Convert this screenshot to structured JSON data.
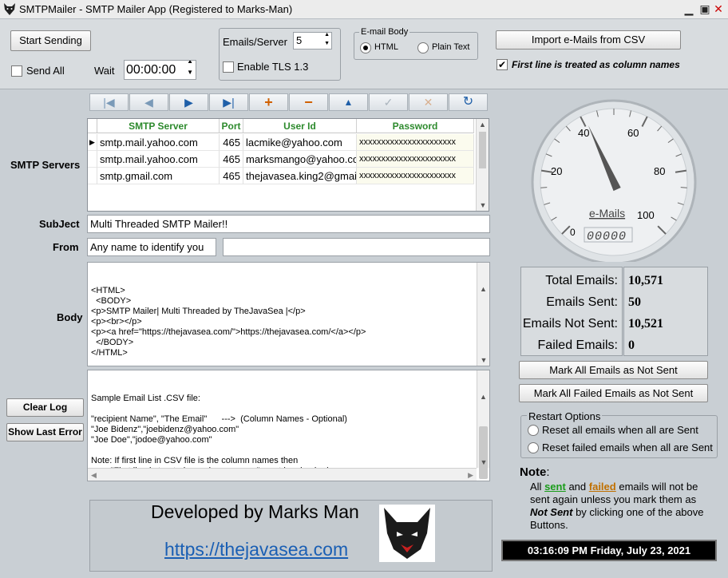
{
  "titlebar": {
    "title": "SMTPMailer - SMTP Mailer App (Registered to Marks-Man)",
    "min": "▁",
    "max": "▣",
    "close": "✕"
  },
  "toolbar": {
    "start_sending": "Start Sending",
    "send_all": "Send All",
    "send_all_checked": false,
    "wait_label": "Wait",
    "wait_value": "00:00:00",
    "emails_per_server_label": "Emails/Server",
    "emails_per_server_value": "5",
    "enable_tls_label": "Enable TLS 1.3",
    "enable_tls_checked": false,
    "email_body_group": "E-mail Body",
    "body_html": "HTML",
    "body_plain": "Plain Text",
    "body_selected": "HTML",
    "import_button": "Import e-Mails from CSV",
    "first_line_label": "First line is treated as column names",
    "first_line_checked": true
  },
  "nav": {
    "first": "|◀",
    "prior": "◀",
    "next": "▶",
    "last": "▶|",
    "insert": "+",
    "delete": "−",
    "edit": "▲",
    "post": "✓",
    "cancel": "✕",
    "refresh": "↻"
  },
  "labels": {
    "smtp_servers": "SMTP Servers",
    "subject": "SubJect",
    "from": "From",
    "body": "Body"
  },
  "grid": {
    "columns": [
      "SMTP Server",
      "Port",
      "User Id",
      "Password"
    ],
    "rows": [
      {
        "server": "smtp.mail.yahoo.com",
        "port": "465",
        "user": "lacmike@yahoo.com",
        "password": "xxxxxxxxxxxxxxxxxxxxxx",
        "current": true
      },
      {
        "server": "smtp.mail.yahoo.com",
        "port": "465",
        "user": "marksmango@yahoo.co",
        "password": "xxxxxxxxxxxxxxxxxxxxxx",
        "current": false
      },
      {
        "server": "smtp.gmail.com",
        "port": "465",
        "user": "thejavasea.king2@gmai",
        "password": "xxxxxxxxxxxxxxxxxxxxxx",
        "current": false
      }
    ]
  },
  "subject_value": "Multi Threaded SMTP Mailer!!",
  "from_name": "Any name to identify you",
  "from_email": "",
  "body_html_text": "<HTML>\n  <BODY>\n<p>SMTP Mailer| Multi Threaded by TheJavaSea |</p>\n<p><br></p>\n<p><a href=\"https://thejavasea.com/\">https://thejavasea.com/</a></p>\n  </BODY>\n</HTML>",
  "log_text": "Sample Email List .CSV file:\n\n\"recipient Name\", \"The Email\"      --->  (Column Names - Optional)\n\"Joe Bidenz\",\"joebidenz@yahoo.com\"\n\"Joe Doe\",\"jodoe@yahoo.com\"\n\nNote: If first line in CSV file is the column names then\n        \"First line is treated as column names\" must be checked.",
  "log_buttons": {
    "clear": "Clear Log",
    "show_error": "Show Last Error"
  },
  "gauge": {
    "label": "e-Mails",
    "ticks": [
      "0",
      "20",
      "40",
      "60",
      "80",
      "100"
    ],
    "value": 41,
    "odometer": "00000"
  },
  "stats": {
    "total_label": "Total Emails:",
    "total_value": "10,571",
    "sent_label": "Emails Sent:",
    "sent_value": "50",
    "not_sent_label": "Emails Not Sent:",
    "not_sent_value": "10,521",
    "failed_label": "Failed Emails:",
    "failed_value": "0"
  },
  "actions": {
    "mark_all": "Mark All Emails as Not Sent",
    "mark_failed": "Mark All Failed Emails as Not Sent"
  },
  "restart": {
    "group": "Restart Options",
    "opt1": "Reset all emails when all are Sent",
    "opt2": "Reset failed emails when all are Sent"
  },
  "note": {
    "title": "Note",
    "colon": ":",
    "all": "All",
    "sent": "sent",
    "and": "and",
    "failed": "failed",
    "line1_rest": "emails will not be",
    "line2": "sent again unless you mark them as",
    "not_sent": "Not Sent",
    "line3_rest": " by clicking one of the above",
    "line4": "Buttons."
  },
  "clock": "03:16:09 PM Friday, July 23, 2021",
  "banner": {
    "title": "Developed by Marks Man",
    "link": "https://thejavasea.com"
  },
  "colors": {
    "accent_green": "#2d8a2d",
    "sent_green": "#1a9c1a",
    "failed_orange": "#c07000",
    "link_blue": "#1a5fb4",
    "clock_bg": "#000000"
  }
}
